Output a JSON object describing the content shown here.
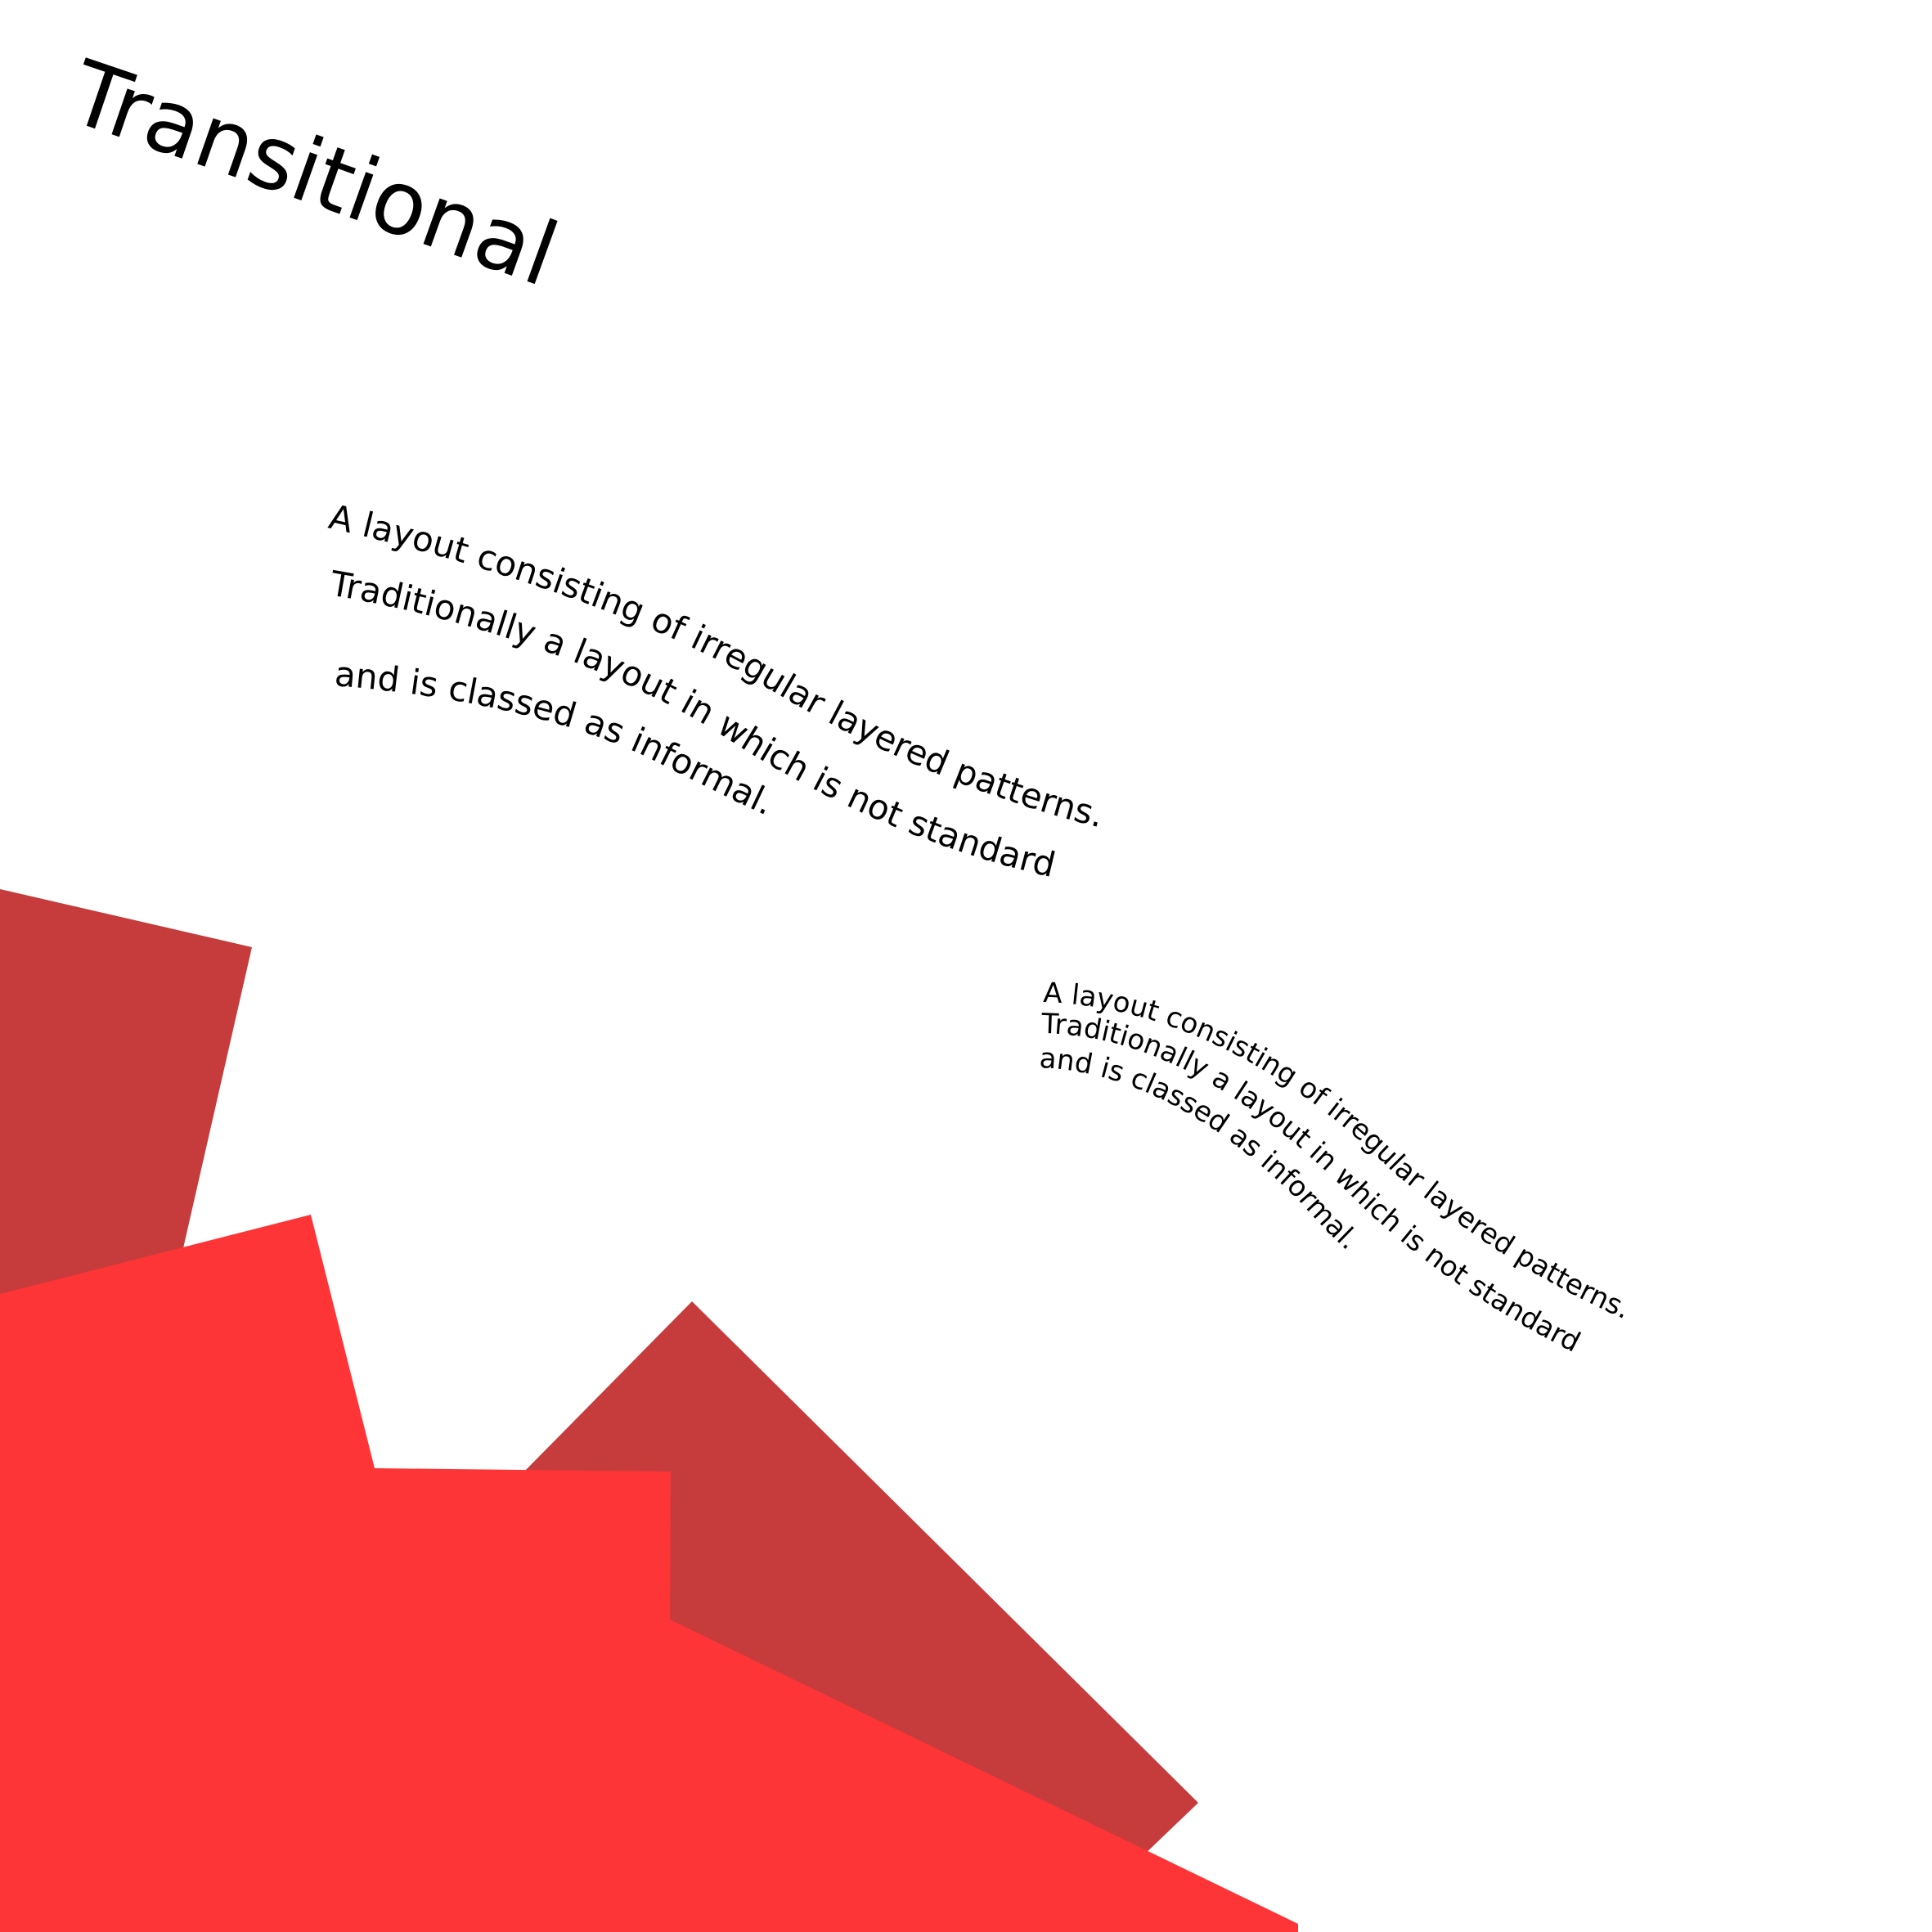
{
  "title": "Transitional",
  "paragraph_primary": {
    "line_1": "A layout consisting of irregular layered patterns.",
    "line_2": "Traditionally a layout in which is not standard",
    "line_3": "and is classed as informal."
  },
  "paragraph_secondary": {
    "line_1": "A layout consisting of irregular layered patterns.",
    "line_2": "Traditionally a layout in which is not standard",
    "line_3": "and is classed as informal."
  },
  "colors": {
    "background": "#ffffff",
    "text": "#000000",
    "dark_red": "#c63b3c",
    "bright_red": "#fe3537"
  }
}
